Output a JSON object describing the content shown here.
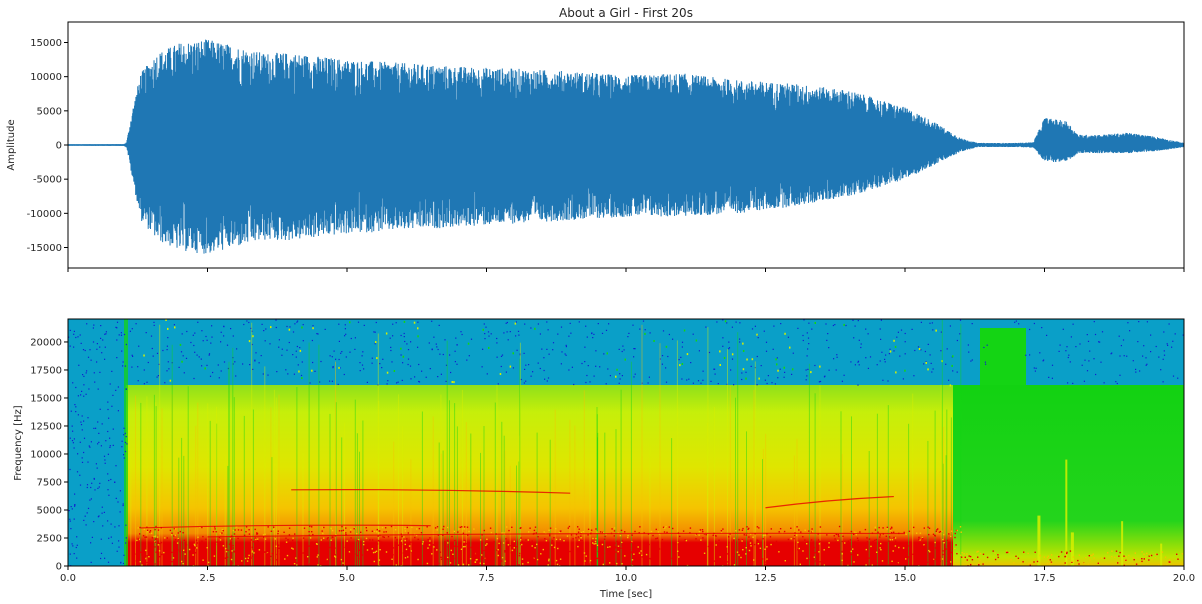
{
  "chart_data": [
    {
      "type": "line",
      "title": "About a Girl - First 20s",
      "xlabel": "",
      "ylabel": "Amplitude",
      "xlim": [
        0,
        20
      ],
      "ylim": [
        -18000,
        18000
      ],
      "yticks": [
        -15000,
        -10000,
        -5000,
        0,
        5000,
        10000,
        15000
      ],
      "xticks": [
        0,
        2.5,
        5,
        7.5,
        10,
        12.5,
        15,
        17.5,
        20
      ],
      "series_color": "#1f77b4",
      "envelope": {
        "x": [
          0,
          1.0,
          1.05,
          1.15,
          1.3,
          1.6,
          2.0,
          2.5,
          3.0,
          3.5,
          4.0,
          4.5,
          5.0,
          6.0,
          7.0,
          8.0,
          9.0,
          10.0,
          11.0,
          12.0,
          13.0,
          14.0,
          15.0,
          15.5,
          16.0,
          16.3,
          17.0,
          17.3,
          17.5,
          17.9,
          18.1,
          18.5,
          19.0,
          19.5,
          20.0
        ],
        "pos": [
          100,
          120,
          400,
          5000,
          10500,
          13500,
          15000,
          15500,
          14500,
          13500,
          13500,
          13000,
          12500,
          12000,
          11500,
          11200,
          10800,
          10200,
          10500,
          9500,
          9000,
          8000,
          5500,
          3500,
          1000,
          300,
          300,
          400,
          4000,
          3500,
          1500,
          1500,
          1800,
          1200,
          300
        ],
        "neg": [
          100,
          120,
          400,
          5000,
          11000,
          14000,
          15500,
          16000,
          15000,
          14000,
          14000,
          13500,
          13000,
          12500,
          12000,
          11500,
          11000,
          10500,
          10500,
          10000,
          9000,
          7500,
          5000,
          3000,
          1000,
          300,
          300,
          400,
          2500,
          2500,
          1200,
          1200,
          1200,
          900,
          300
        ]
      }
    },
    {
      "type": "heatmap",
      "title": "",
      "xlabel": "Time [sec]",
      "ylabel": "Frequency [Hz]",
      "xlim": [
        0,
        20
      ],
      "ylim": [
        0,
        22050
      ],
      "yticks": [
        0,
        2500,
        5000,
        7500,
        10000,
        12500,
        15000,
        17500,
        20000
      ],
      "xticks": [
        0,
        2.5,
        5,
        7.5,
        10,
        12.5,
        15,
        17.5,
        20
      ],
      "xtick_labels": [
        "0.0",
        "2.5",
        "5.0",
        "7.5",
        "10.0",
        "12.5",
        "15.0",
        "17.5",
        "20.0"
      ],
      "colors": {
        "silence": "#0a9fc8",
        "low": "#14d414",
        "mid": "#d6ef00",
        "high": "#f5c400",
        "peak": "#e60000",
        "speck": "#1020d0"
      },
      "regions": {
        "onset_time": 1.05,
        "music_end_time": 16.0,
        "lowpass_cutoff_hz": 16200,
        "noise_block": [
          16.5,
          17.15,
          21200
        ]
      }
    }
  ]
}
